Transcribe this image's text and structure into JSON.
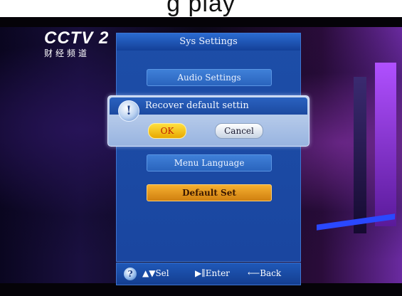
{
  "caption_fragment": "g                              play",
  "channel": {
    "logo": "CCTV 2",
    "subtitle": "财经频道"
  },
  "sys_settings": {
    "title": "Sys Settings",
    "menu_items": [
      {
        "label": "Audio Settings",
        "selected": false
      },
      {
        "label": "Menu Language",
        "selected": false
      },
      {
        "label": "Default Set",
        "selected": true
      }
    ],
    "footer": {
      "help_icon": "?",
      "select_hint": "▲▼Sel",
      "enter_hint": "▶∥Enter",
      "back_hint": "⟵Back"
    }
  },
  "dialog": {
    "icon": "!",
    "message": "Recover default settin",
    "ok_label": "OK",
    "cancel_label": "Cancel"
  },
  "colors": {
    "panel_blue": "#1d4ea8",
    "selected_orange": "#f6b030",
    "ok_yellow": "#ffe040"
  }
}
